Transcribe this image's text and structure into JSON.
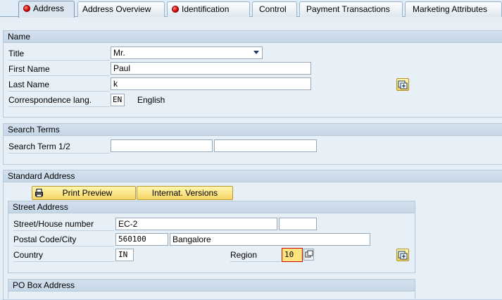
{
  "tabs": [
    {
      "label": "Address",
      "error": true
    },
    {
      "label": "Address Overview",
      "error": false
    },
    {
      "label": "Identification",
      "error": true
    },
    {
      "label": "Control",
      "error": false
    },
    {
      "label": "Payment Transactions",
      "error": false
    },
    {
      "label": "Marketing Attributes",
      "error": false
    }
  ],
  "name_section": {
    "title": "Name",
    "title_label": "Title",
    "title_value": "Mr.",
    "first_name_label": "First Name",
    "first_name_value": "Paul",
    "last_name_label": "Last Name",
    "last_name_value": "k",
    "corr_lang_label": "Correspondence lang.",
    "corr_lang_code": "EN",
    "corr_lang_text": "English"
  },
  "search_terms": {
    "title": "Search Terms",
    "label": "Search Term 1/2",
    "term1": "",
    "term2": ""
  },
  "standard_address": {
    "title": "Standard Address",
    "print_preview_label": "Print Preview",
    "internat_versions_label": "Internat. Versions",
    "street_address": {
      "title": "Street Address",
      "street_label": "Street/House number",
      "street_value": "EC-2",
      "house_number": "",
      "postal_label": "Postal Code/City",
      "postal_code": "560100",
      "city": "Bangalore",
      "country_label": "Country",
      "country_value": "IN",
      "region_label": "Region",
      "region_value": "10"
    },
    "po_box": {
      "title": "PO Box Address"
    }
  },
  "icons": {
    "tab_error": "red-dot-icon",
    "more_fields": "expand-fields-icon",
    "printer": "printer-icon",
    "value_help": "value-help-icon"
  },
  "colors": {
    "background": "#dfebf5",
    "button_yellow": "#f5d564",
    "error_red": "#d40000"
  }
}
